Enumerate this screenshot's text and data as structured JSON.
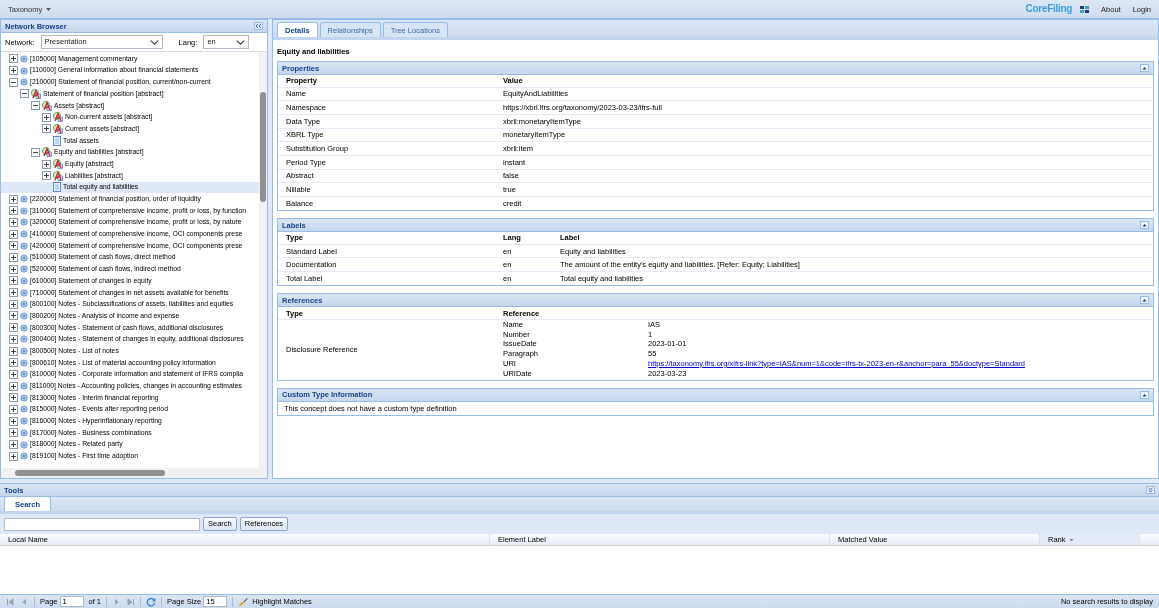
{
  "top_bar": {
    "menu": "Taxonomy",
    "brand": "**Core**Filing",
    "links": [
      "About",
      "Login"
    ]
  },
  "network_browser": {
    "title": "Network Browser",
    "network_label": "Network:",
    "network": "Presentation",
    "lang_label": "Lang:",
    "lang": "en",
    "tree": [
      {
        "kind": "network",
        "label": "[105000] Management commentary",
        "expanded": false,
        "selected": false
      },
      {
        "kind": "network",
        "label": "[110000] General information about financial statements",
        "expanded": false,
        "selected": false
      },
      {
        "kind": "network",
        "label": "[210000] Statement of financial position, current/non-current",
        "expanded": true,
        "selected": false,
        "children": [
          {
            "kind": "abstract",
            "label": "Statement of financial position [abstract]",
            "expanded": true,
            "selected": false,
            "children": [
              {
                "kind": "abstract",
                "label": "Assets [abstract]",
                "expanded": true,
                "selected": false,
                "children": [
                  {
                    "kind": "abstract",
                    "label": "Non-current assets [abstract]",
                    "expanded": false,
                    "selected": false
                  },
                  {
                    "kind": "abstract",
                    "label": "Current assets [abstract]",
                    "expanded": false,
                    "selected": false
                  },
                  {
                    "kind": "concept",
                    "label": "Total assets",
                    "selected": false
                  }
                ]
              },
              {
                "kind": "abstract",
                "label": "Equity and liabilities [abstract]",
                "expanded": true,
                "selected": false,
                "children": [
                  {
                    "kind": "abstract",
                    "label": "Equity [abstract]",
                    "expanded": false,
                    "selected": false
                  },
                  {
                    "kind": "abstract",
                    "label": "Liabilities [abstract]",
                    "expanded": false,
                    "selected": false
                  },
                  {
                    "kind": "concept",
                    "label": "Total equity and liabilities",
                    "selected": true
                  }
                ]
              }
            ]
          }
        ]
      },
      {
        "kind": "network",
        "label": "[220000] Statement of financial position, order of liquidity",
        "expanded": false,
        "selected": false
      },
      {
        "kind": "network",
        "label": "[310000] Statement of comprehensive income, profit or loss, by function",
        "expanded": false,
        "selected": false
      },
      {
        "kind": "network",
        "label": "[320000] Statement of comprehensive income, profit or loss, by nature",
        "expanded": false,
        "selected": false
      },
      {
        "kind": "network",
        "label": "[410000] Statement of comprehensive income, OCI components prese",
        "expanded": false,
        "selected": false
      },
      {
        "kind": "network",
        "label": "[420000] Statement of comprehensive income, OCI components prese",
        "expanded": false,
        "selected": false
      },
      {
        "kind": "network",
        "label": "[510000] Statement of cash flows, direct method",
        "expanded": false,
        "selected": false
      },
      {
        "kind": "network",
        "label": "[520000] Statement of cash flows, indirect method",
        "expanded": false,
        "selected": false
      },
      {
        "kind": "network",
        "label": "[610000] Statement of changes in equity",
        "expanded": false,
        "selected": false
      },
      {
        "kind": "network",
        "label": "[710000] Statement of changes in net assets available for benefits",
        "expanded": false,
        "selected": false
      },
      {
        "kind": "network",
        "label": "[800100] Notes - Subclassifications of assets, liabilities and equities",
        "expanded": false,
        "selected": false
      },
      {
        "kind": "network",
        "label": "[800200] Notes - Analysis of income and expense",
        "expanded": false,
        "selected": false
      },
      {
        "kind": "network",
        "label": "[800300] Notes - Statement of cash flows, additional disclosures",
        "expanded": false,
        "selected": false
      },
      {
        "kind": "network",
        "label": "[800400] Notes - Statement of changes in equity, additional disclosures",
        "expanded": false,
        "selected": false
      },
      {
        "kind": "network",
        "label": "[800500] Notes - List of notes",
        "expanded": false,
        "selected": false
      },
      {
        "kind": "network",
        "label": "[800610] Notes - List of material accounting policy information",
        "expanded": false,
        "selected": false
      },
      {
        "kind": "network",
        "label": "[810000] Notes - Corporate information and statement of IFRS complia",
        "expanded": false,
        "selected": false
      },
      {
        "kind": "network",
        "label": "[811000] Notes - Accounting policies, changes in accounting estimates",
        "expanded": false,
        "selected": false
      },
      {
        "kind": "network",
        "label": "[813000] Notes - Interim financial reporting",
        "expanded": false,
        "selected": false
      },
      {
        "kind": "network",
        "label": "[815000] Notes - Events after reporting period",
        "expanded": false,
        "selected": false
      },
      {
        "kind": "network",
        "label": "[816000] Notes - Hyperinflationary reporting",
        "expanded": false,
        "selected": false
      },
      {
        "kind": "network",
        "label": "[817000] Notes - Business combinations",
        "expanded": false,
        "selected": false
      },
      {
        "kind": "network",
        "label": "[818000] Notes - Related party",
        "expanded": false,
        "selected": false
      },
      {
        "kind": "network",
        "label": "[819100] Notes - First time adoption",
        "expanded": false,
        "selected": false
      }
    ]
  },
  "details": {
    "tabs": [
      {
        "label": "Details",
        "selected": true
      },
      {
        "label": "Relationships",
        "selected": false
      },
      {
        "label": "Tree Locations",
        "selected": false
      }
    ],
    "title": "Equity and liabilities",
    "properties": {
      "title": "Properties",
      "columns": [
        "Property",
        "Value"
      ],
      "rows": [
        [
          "Name",
          "EquityAndLiabilities"
        ],
        [
          "Namespace",
          "https://xbrl.ifrs.org/taxonomy/2023-03-23/ifrs-full"
        ],
        [
          "Data Type",
          "xbrli:monetaryItemType"
        ],
        [
          "XBRL Type",
          "monetaryItemType"
        ],
        [
          "Substitution Group",
          "xbrli:item"
        ],
        [
          "Period Type",
          "instant"
        ],
        [
          "Abstract",
          "false"
        ],
        [
          "Nillable",
          "true"
        ],
        [
          "Balance",
          "credit"
        ]
      ]
    },
    "labels": {
      "title": "Labels",
      "columns": [
        "Type",
        "Lang",
        "Label"
      ],
      "rows": [
        [
          "Standard Label",
          "en",
          "Equity and liabilities"
        ],
        [
          "Documentation",
          "en",
          "The amount of the entity's equity and liabilities. [Refer: Equity; Liabilities]"
        ],
        [
          "Total Label",
          "en",
          "Total equity and liabilities"
        ]
      ]
    },
    "references": {
      "title": "References",
      "columns": [
        "Type",
        "Reference"
      ],
      "rows": [
        {
          "type": "Disclosure Reference",
          "parts": [
            {
              "kind": "text",
              "name": "Name",
              "value": "IAS"
            },
            {
              "kind": "text",
              "name": "Number",
              "value": "1"
            },
            {
              "kind": "text",
              "name": "IssueDate",
              "value": "2023-01-01"
            },
            {
              "kind": "text",
              "name": "Paragraph",
              "value": "55"
            },
            {
              "kind": "link",
              "name": "URI",
              "value": "https://taxonomy.ifrs.org/xifrs-link?type=IAS&num=1&code=ifrs-tx-2023-en-r&anchor=para_55&doctype=Standard"
            },
            {
              "kind": "text",
              "name": "URIDate",
              "value": "2023-03-23"
            }
          ]
        }
      ]
    },
    "custom_type": {
      "title": "Custom Type Information",
      "text": "This concept does not have a custom type definition"
    }
  },
  "tools": {
    "title": "Tools",
    "tabs": [
      {
        "label": "Search",
        "selected": true
      }
    ],
    "buttons": [
      "Search",
      "References"
    ],
    "columns": [
      "Local Name",
      "Element Label",
      "Matched Value",
      "Rank"
    ],
    "pager": {
      "nav": [
        {
          "kind": "first",
          "disabled": true
        },
        {
          "kind": "prev",
          "disabled": true
        },
        {
          "kind": "next",
          "disabled": true
        },
        {
          "kind": "last",
          "disabled": true
        }
      ],
      "page_label": "Page",
      "page": "1",
      "of": "of 1",
      "size_label": "Page Size",
      "size": "15",
      "highlight": "Highlight Matches",
      "status": "No search results to display"
    }
  }
}
